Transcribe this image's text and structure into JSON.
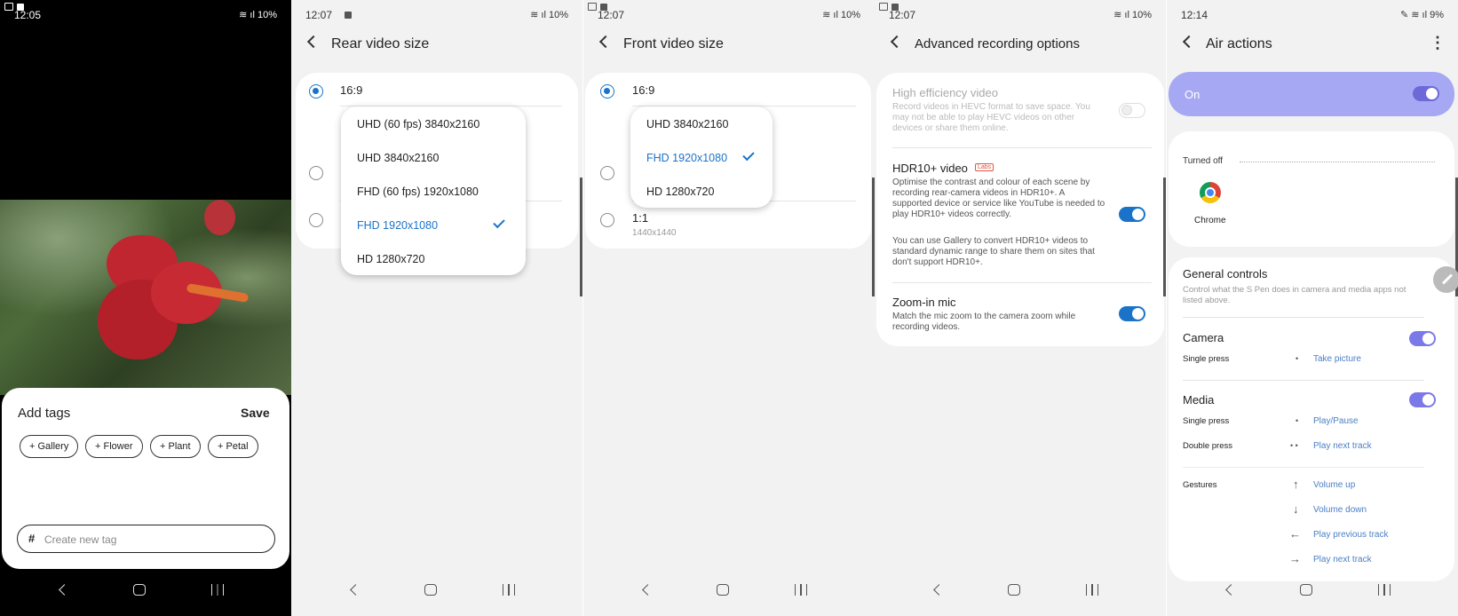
{
  "screen1": {
    "time": "12:05",
    "battery": "10%",
    "title": "Add tags",
    "save": "Save",
    "tags": [
      "Gallery",
      "Flower",
      "Plant",
      "Petal"
    ],
    "input_placeholder": "Create new tag"
  },
  "screen2": {
    "time": "12:07",
    "battery": "10%",
    "title": "Rear video size",
    "ratio": "16:9",
    "options": [
      "UHD (60 fps) 3840x2160",
      "UHD 3840x2160",
      "FHD (60 fps) 1920x1080",
      "FHD 1920x1080",
      "HD 1280x720"
    ]
  },
  "screen3": {
    "time": "12:07",
    "battery": "10%",
    "title": "Front video size",
    "ratio": "16:9",
    "options": [
      "UHD 3840x2160",
      "FHD 1920x1080",
      "HD 1280x720"
    ],
    "ratio2": "1:1",
    "ratio2_sub": "1440x1440"
  },
  "screen4": {
    "time": "12:07",
    "battery": "10%",
    "title": "Advanced recording options",
    "hev_title": "High efficiency video",
    "hev_desc": "Record videos in HEVC format to save space. You may not be able to play HEVC videos on other devices or share them online.",
    "hdr_title": "HDR10+ video",
    "labs": "Labs",
    "hdr_desc": "Optimise the contrast and colour of each scene by recording rear-camera videos in HDR10+. A supported device or service like YouTube is needed to play HDR10+ videos correctly.",
    "hdr_desc2": "You can use Gallery to convert HDR10+ videos to standard dynamic range to share them on sites that don't support HDR10+.",
    "zoom_title": "Zoom-in mic",
    "zoom_desc": "Match the mic zoom to the camera zoom while recording videos."
  },
  "screen5": {
    "time": "12:14",
    "battery": "9%",
    "title": "Air actions",
    "on": "On",
    "turned_off": "Turned off",
    "chrome": "Chrome",
    "general_title": "General controls",
    "general_desc": "Control what the S Pen does in camera and media apps not listed above.",
    "camera": "Camera",
    "single_press": "Single press",
    "take_picture": "Take picture",
    "media": "Media",
    "play_pause": "Play/Pause",
    "double_press": "Double press",
    "play_next": "Play next track",
    "gestures": "Gestures",
    "volume_up": "Volume up",
    "volume_down": "Volume down",
    "play_prev": "Play previous track",
    "play_next2": "Play next track"
  }
}
